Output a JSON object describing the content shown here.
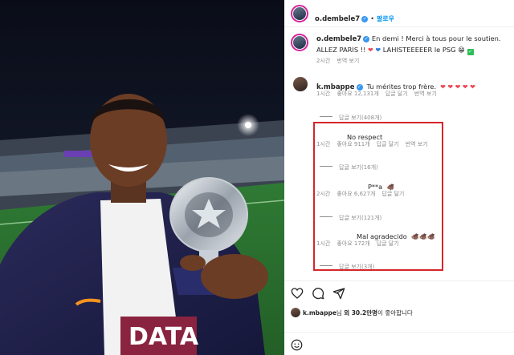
{
  "post": {
    "username": "o.dembele7",
    "follow_label": "팔로우",
    "caption_text": "En demi ! Merci à tous pour le soutien. ALLEZ PARIS !!",
    "caption_tail": "LAHISTEEEEER le PSG",
    "caption_time": "2시간",
    "caption_translate": "번역 보기"
  },
  "comment": {
    "username": "k.mbappe",
    "text": "Tu mérites trop frère.",
    "time": "1시간",
    "likes": "좋아요 12,131개",
    "reply": "답글 달기",
    "translate": "번역 보기",
    "view_replies": "답글 보기(408개)"
  },
  "replies": [
    {
      "text": "No respect",
      "time": "1시간",
      "likes": "좋아요 911개",
      "reply": "답글 달기",
      "translate": "번역 보기",
      "view_replies": "답글 보기(16개)"
    },
    {
      "text": "P**a",
      "time": "2시간",
      "likes": "좋아요 6,627개",
      "reply": "답글 달기",
      "view_replies": "답글 보기(121개)"
    },
    {
      "text": "Mal agradecido",
      "time": "1시간",
      "likes": "좋아요 172개",
      "reply": "답글 달기",
      "view_replies": "답글 보기(3개)"
    }
  ],
  "likes_bar": {
    "user": "k.mbappe",
    "suffix_1": "님 ",
    "count": "외 30.2만명",
    "suffix_2": "이 좋아합니다"
  },
  "photo": {
    "jersey_text": "DATA"
  },
  "colors": {
    "accent_blue": "#0095f6",
    "highlight_red": "#d6262a",
    "heart_red": "#ed4956",
    "muted_gray": "#8e8e8e"
  },
  "icons": [
    "heart-icon",
    "comment-icon",
    "share-icon",
    "emoji-icon",
    "verified-icon",
    "boar-icon",
    "trophy"
  ]
}
